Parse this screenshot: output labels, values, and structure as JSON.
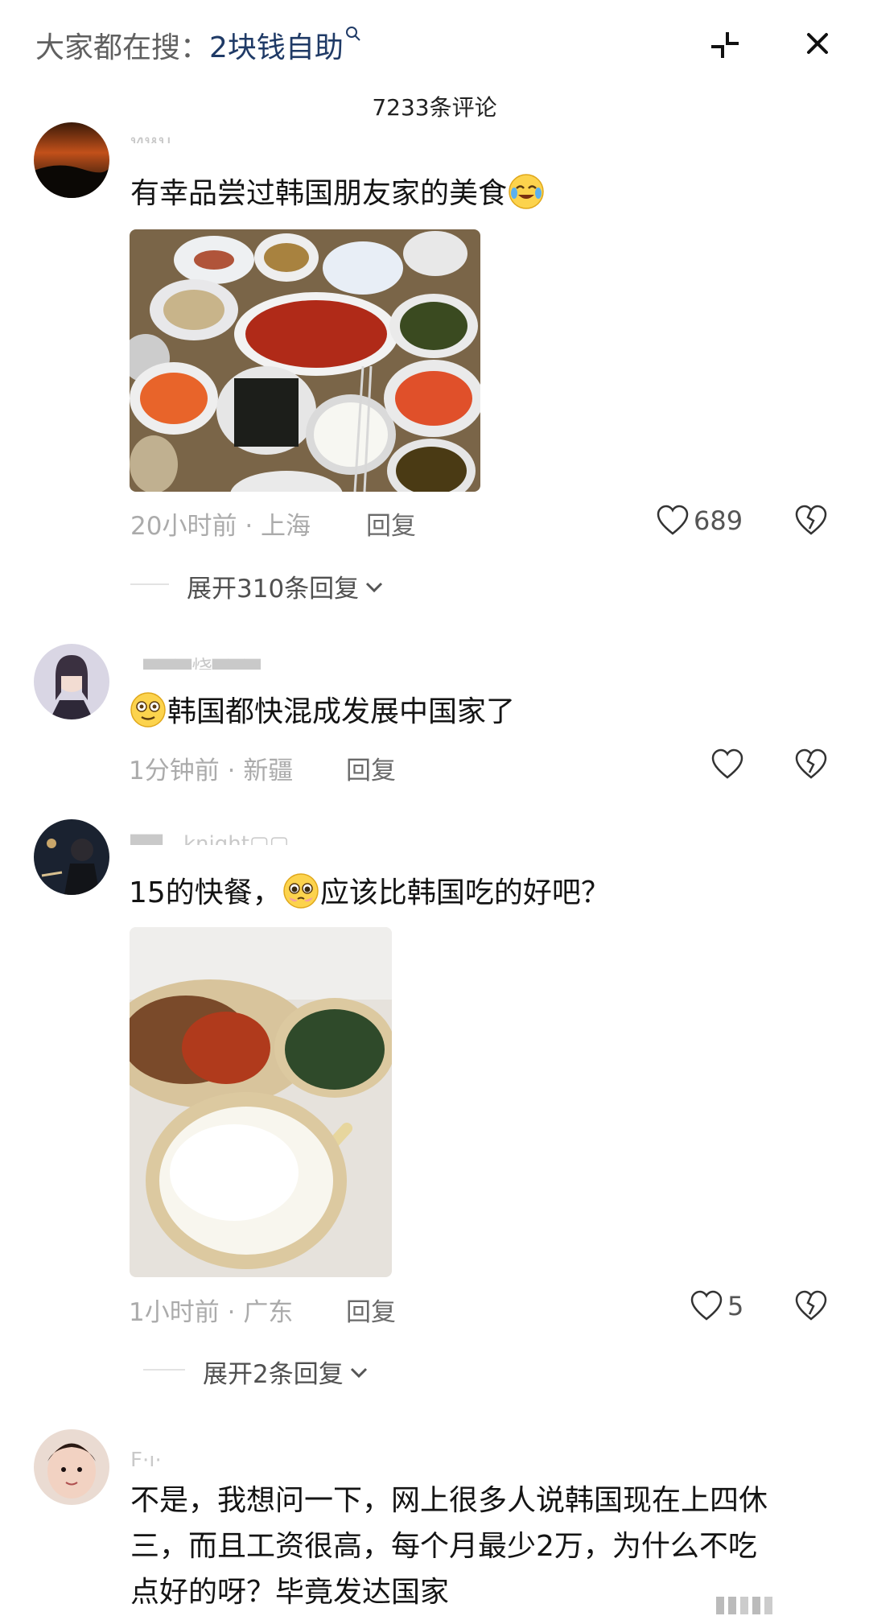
{
  "header": {
    "search_prefix": "大家都在搜：",
    "search_term": "2块钱自助",
    "comment_count": "7233条评论"
  },
  "comments": [
    {
      "username": "ทหม",
      "text": "有幸品尝过韩国朋友家的美食",
      "emoji": "crying-laughing-emoji",
      "time": "20小时前",
      "location": "上海",
      "reply_label": "回复",
      "likes": "689",
      "expand_label": "展开310条回复"
    },
    {
      "username": "▇▇▇烧▇▇▇",
      "text": "韩国都快混成发展中国家了",
      "emoji": "dizzy-face-emoji",
      "time": "1分钟前",
      "location": "新疆",
      "reply_label": "回复",
      "likes": ""
    },
    {
      "username": "▇▇。knight▢▢",
      "text_before": "15的快餐，",
      "text_after": "应该比韩国吃的好吧？",
      "emoji": "teary-face-emoji",
      "time": "1小时前",
      "location": "广东",
      "reply_label": "回复",
      "likes": "5",
      "expand_label": "展开2条回复"
    },
    {
      "username": "F·ı·",
      "text_line1": "不是，我想问一下，网上很多人说韩国现在上四休",
      "text_line2": "三，而且工资很高，每个月最少2万，为什么不吃",
      "text_line3": "点好的呀？毕竟发达国家"
    }
  ],
  "colors": {
    "accent": "#1f3a66",
    "meta": "#ababab",
    "divider": "#e3e3e3"
  },
  "icons": [
    "search-icon",
    "collapse-icon",
    "close-icon",
    "heart-icon",
    "broken-heart-icon",
    "chevron-down-icon"
  ]
}
